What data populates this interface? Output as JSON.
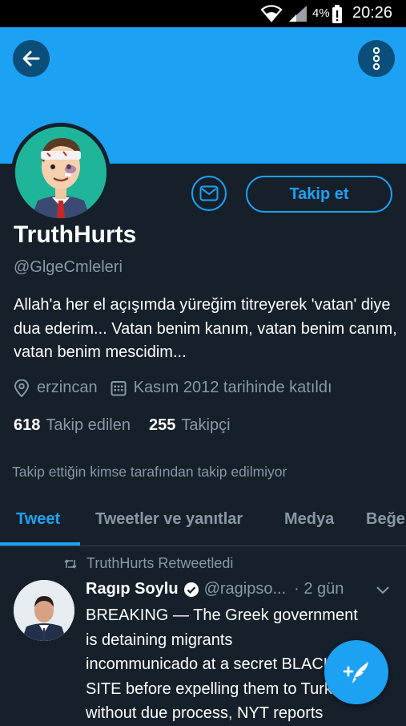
{
  "status_bar": {
    "battery_percent": "4%",
    "time": "20:26"
  },
  "profile": {
    "follow_label": "Takip et",
    "name": "TruthHurts",
    "handle": "@GlgeCmleleri",
    "bio": "Allah'a her el açışımda yüreğim titreyerek 'vatan' diye dua ederim... Vatan benim kanım, vatan benim canım, vatan benim mescidim...",
    "location": "erzincan",
    "joined": "Kasım 2012 tarihinde katıldı",
    "following_count": "618",
    "following_label": "Takip edilen",
    "followers_count": "255",
    "followers_label": "Takipçi",
    "followed_by_text": "Takip ettiğin kimse tarafından takip edilmiyor"
  },
  "tabs": [
    {
      "label": "Tweet",
      "active": true
    },
    {
      "label": "Tweetler ve yanıtlar",
      "active": false
    },
    {
      "label": "Medya",
      "active": false
    },
    {
      "label": "Beğe",
      "active": false
    }
  ],
  "tweet": {
    "retweeted_by": "TruthHurts Retweetledi",
    "author_name": "Ragıp Soylu",
    "author_handle": "@ragipso...",
    "time": "· 2 gün",
    "lines": [
      "BREAKING — The Greek government",
      "is detaining migrants",
      "incommunicado at a secret BLACK",
      "SITE before expelling them to Turkey",
      "without due process, NYT reports"
    ]
  },
  "colors": {
    "background": "#15202b",
    "accent": "#1da1f2",
    "secondary_text": "#8899a6"
  },
  "icons": [
    "wifi-icon",
    "signal-icon",
    "battery-alert-icon",
    "back-arrow-icon",
    "more-vertical-icon",
    "mail-icon",
    "location-pin-icon",
    "calendar-icon",
    "retweet-icon",
    "verified-badge-icon",
    "chevron-down-icon",
    "compose-tweet-icon"
  ]
}
